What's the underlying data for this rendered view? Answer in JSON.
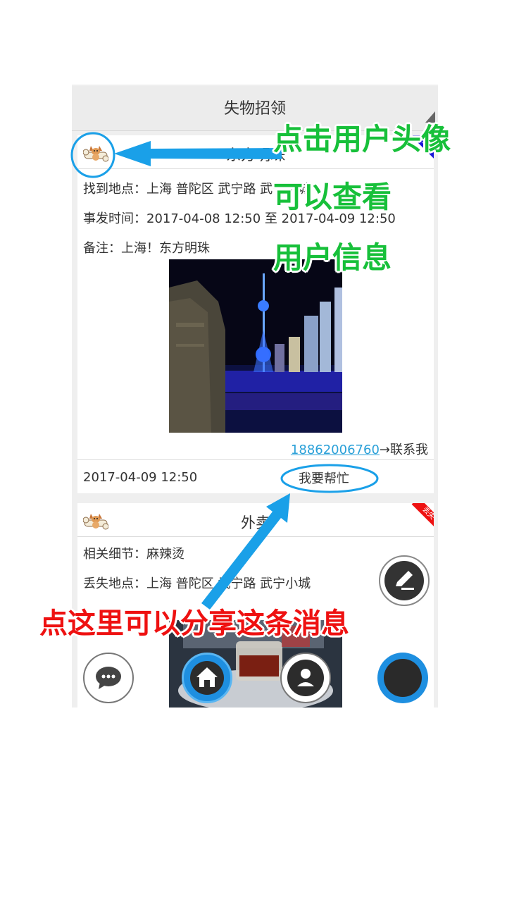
{
  "app": {
    "title": "失物招领"
  },
  "posts": [
    {
      "title": "东方明珠",
      "badge": "招领",
      "badge_color": "#1a16d8",
      "rows": [
        {
          "label": "找到地点：",
          "value": "上海 普陀区 武宁路 武宁小城"
        },
        {
          "label": "事发时间：",
          "value": "2017-04-08 12:50 至 2017-04-09 12:50"
        },
        {
          "label": "备注：",
          "value": "上海！东方明珠"
        }
      ],
      "phone": "18862006760",
      "contact_suffix": "→联系我",
      "date": "2017-04-09 12:50",
      "help_label": "我要帮忙"
    },
    {
      "title": "外卖",
      "badge": "丢失",
      "badge_color": "#ee1111",
      "rows": [
        {
          "label": "相关细节：",
          "value": "麻辣烫"
        },
        {
          "label": "丢失地点：",
          "value": "上海 普陀区 武宁路 武宁小城"
        }
      ]
    }
  ],
  "annotations": {
    "green_line1": "点击用户头像",
    "green_line2": "可以查看",
    "green_line3": "用户信息",
    "red_line": "点这里可以分享这条消息",
    "green_color": "#17c03a",
    "red_color": "#ee1111",
    "arrow_color": "#1aa0e8"
  },
  "icons": {
    "avatar": "dog-avatar-icon",
    "edit": "edit-pencil-icon",
    "chat": "chat-bubble-icon",
    "home": "home-icon",
    "user": "user-icon"
  }
}
